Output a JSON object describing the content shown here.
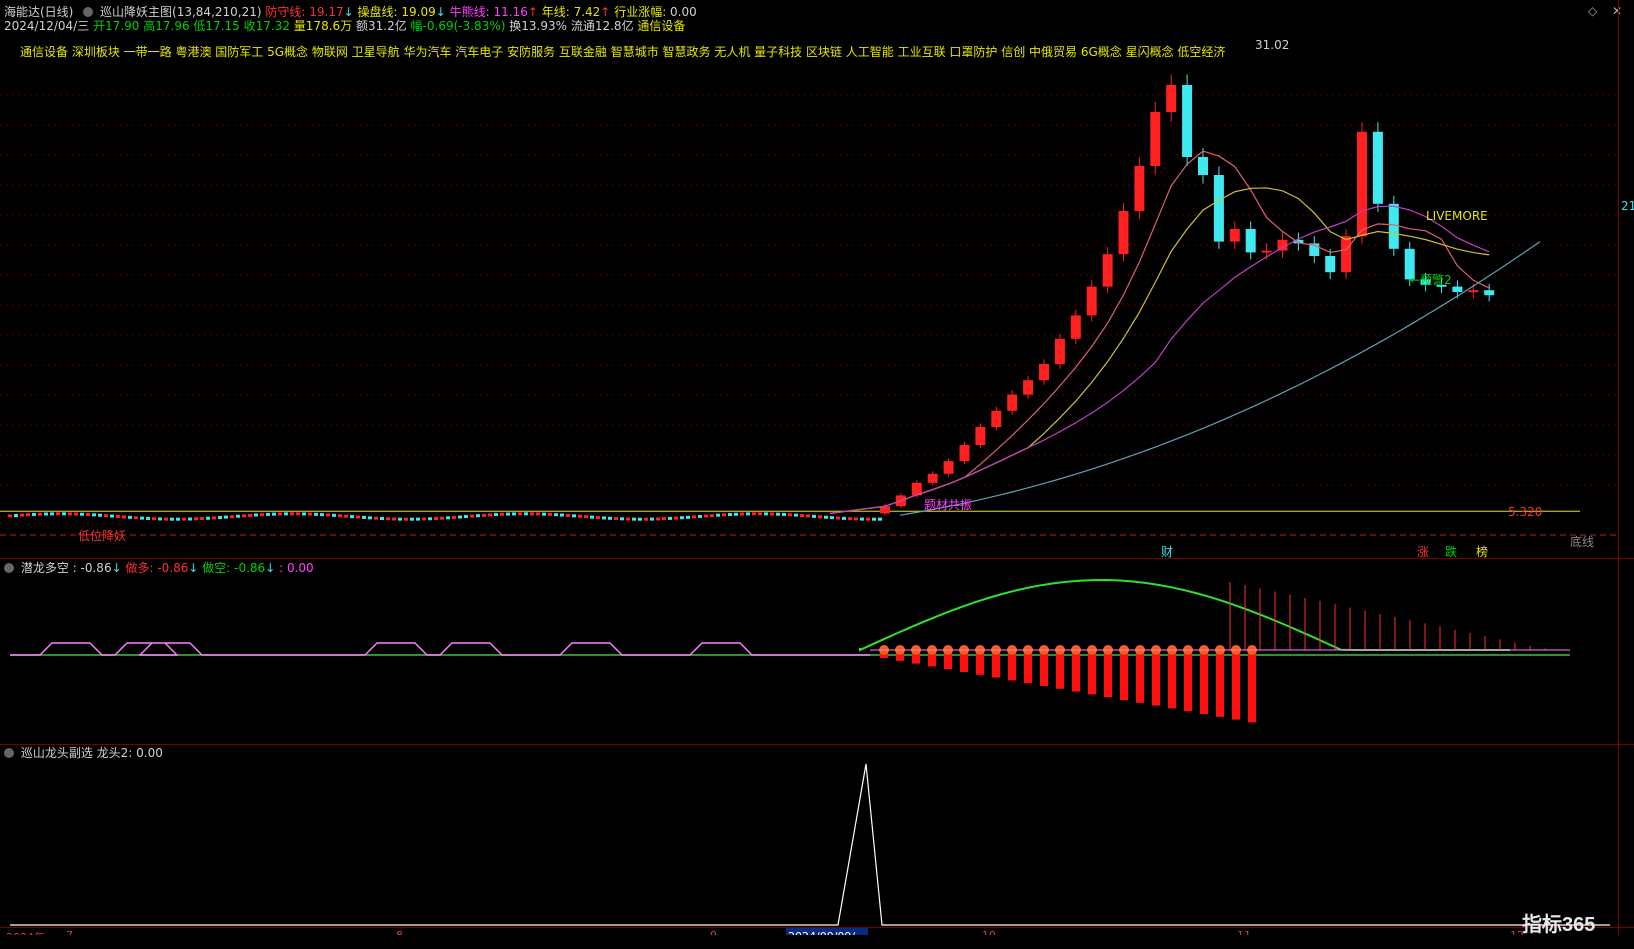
{
  "header": {
    "app": "海能达(日线)",
    "indicator": "巡山降妖主图(13,84,210,21)",
    "defense_label": "防守线: ",
    "defense_value": "19.17",
    "control_label": "操盘线: ",
    "control_value": "19.09",
    "bull_label": "牛熊线: ",
    "bull_value": "11.16",
    "year_label": "年线: ",
    "year_value": "7.42",
    "industry_label": "行业涨幅: ",
    "industry_value": "0.00",
    "arrow_down": "↓",
    "arrow_up": "↑"
  },
  "quote": {
    "date": "2024/12/04/三",
    "open": "开17.90",
    "high": "高17.96",
    "low": "低17.15",
    "close": "收17.32",
    "volume": "量178.6万",
    "amount": "额31.2亿",
    "change": "幅-0.69(-3.83%)",
    "turnover": "换13.93%",
    "float": "流通12.8亿",
    "sector": "通信设备"
  },
  "concepts": "通信设备 深圳板块 一带一路 粤港澳 国防军工 5G概念 物联网 卫星导航 华为汽车 汽车电子 安防服务 互联金融 智慧城市 智慧政务 无人机 量子科技 区块链 人工智能 工业互联 口罩防护 信创 中俄贸易 6G概念 星闪概念 低空经济",
  "annotations": {
    "peak": "31.02",
    "level": "5.320",
    "bottom_line": "底线",
    "livemore": "LIVEMORE",
    "warn": "←预警2",
    "resonance": "题材共振",
    "trap": "低位降妖",
    "cai": "财",
    "zhang": "涨",
    "die": "跌",
    "bang": "榜",
    "right_edge": "21"
  },
  "panel2": {
    "title": "潜龙多空",
    "value": ": -0.86",
    "arrow": "↓",
    "l1_label": "做多: ",
    "l1_value": "-0.86",
    "l2_label": "做空: ",
    "l2_value": "-0.86",
    "l3": ": 0.00"
  },
  "panel3": {
    "title": "巡山龙头副选",
    "value": "龙头2: 0.00"
  },
  "xaxis": {
    "year": "2024年",
    "ticks": [
      "7",
      "8",
      "9",
      "10",
      "11",
      "12"
    ],
    "cursor": "2024/09/09/一"
  },
  "logo": "指标365",
  "colors": {
    "up": "#ff2020",
    "down": "#40e8f0",
    "defense": "#e06070",
    "control": "#d0c030",
    "bull": "#c040c0",
    "year": "#60a0b0"
  },
  "chart_data": {
    "type": "candlestick",
    "range": "2024-07 to 2024-12",
    "y_reference": {
      "level": 5.32,
      "peak": 31.02
    },
    "last_bar": {
      "date": "2024/12/04",
      "open": 17.9,
      "high": 17.96,
      "low": 17.15,
      "close": 17.32
    },
    "indicator_values": {
      "defense": 19.17,
      "control": 19.09,
      "bull_bear": 11.16,
      "year": 7.42
    },
    "rally_closes": [
      5.6,
      6.2,
      6.9,
      7.4,
      8.1,
      9.0,
      10.0,
      10.9,
      11.8,
      12.6,
      13.5,
      14.9,
      16.2,
      17.8,
      19.6,
      22.0,
      24.5,
      27.5,
      29.0,
      25.0,
      24.0,
      20.3,
      21.0,
      19.7,
      19.8,
      20.4,
      20.2,
      19.5,
      18.6,
      20.6,
      26.4,
      22.4,
      19.9,
      18.2,
      17.9,
      17.8,
      17.5,
      17.6,
      17.32
    ]
  }
}
